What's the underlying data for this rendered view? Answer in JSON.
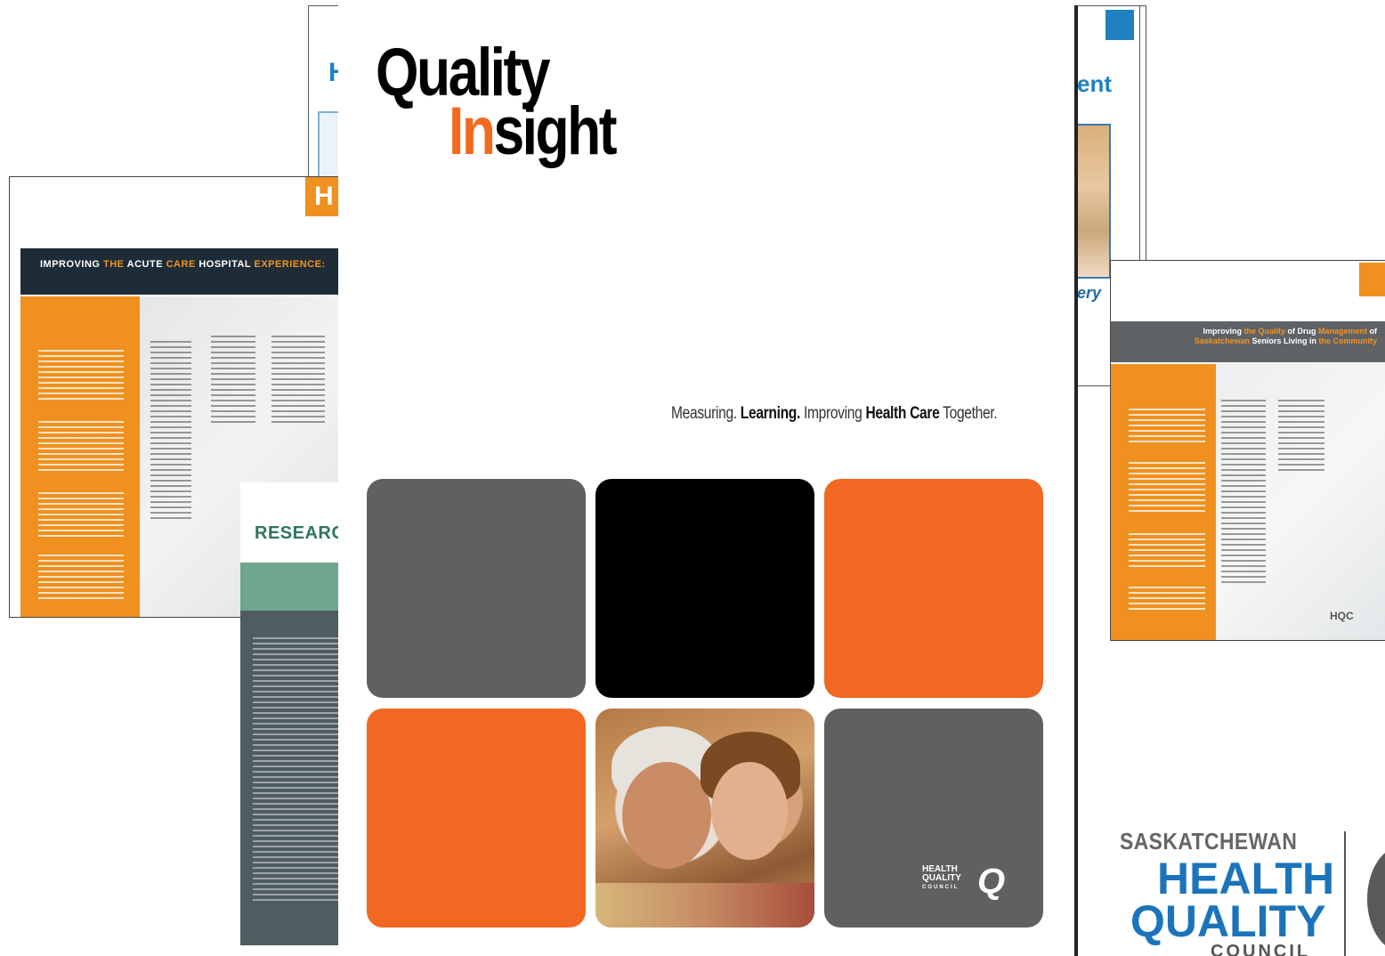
{
  "cover": {
    "logo_word1": "Quality",
    "logo_word2_accent": "In",
    "logo_word2_rest": "sight",
    "tagline": {
      "part1": "Measuring. ",
      "part2": "Learning.",
      "part3": " Improving ",
      "part4": "Health Care",
      "part5": " Together."
    },
    "tiles": [
      "grey",
      "black",
      "orange",
      "orange",
      "photo",
      "grey"
    ],
    "mini_logo_lines": [
      "HEALTH",
      "QUALITY",
      "COUNCIL"
    ],
    "mini_logo_mark": "Q"
  },
  "doc_acute": {
    "title_parts": [
      "IMPROVING ",
      "THE",
      " ACUTE ",
      "CARE",
      " HOSPITAL ",
      "EXPERIENCE:"
    ],
    "tab_letter": "H"
  },
  "doc_back": {
    "title_fragment": "H"
  },
  "doc_ent": {
    "title_fragment": "ent",
    "subtitle_fragment": "ery"
  },
  "doc_research": {
    "title": "RESEARCH"
  },
  "doc_drug": {
    "title_line1_parts": [
      "Improving ",
      "the Quality",
      " of Drug ",
      "Management",
      " of"
    ],
    "title_line2_parts": [
      "Saskatchewan",
      " Seniors Living in ",
      "the Community"
    ],
    "mini_logo": "HQC"
  },
  "shqc_logo": {
    "line1": "SASKATCHEWAN",
    "line2": "HEALTH",
    "line3": "QUALITY",
    "line4": "COUNCIL"
  },
  "colors": {
    "orange": "#f26722",
    "amber": "#f0901e",
    "grey": "#606063",
    "blue": "#1b74bb",
    "navy_banner": "#1e2c37",
    "green": "#2f7560"
  }
}
